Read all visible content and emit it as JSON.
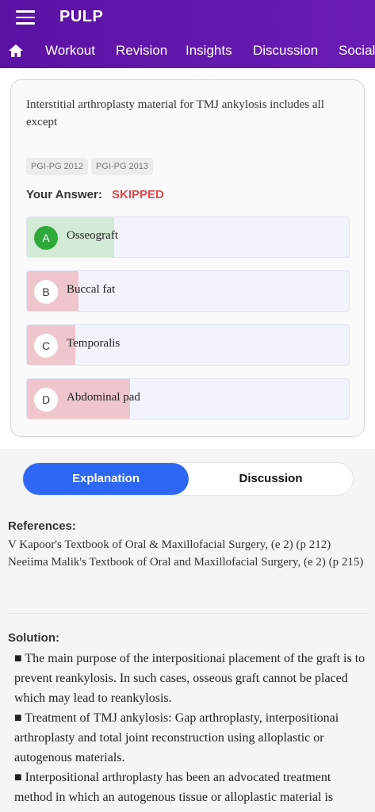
{
  "app": {
    "title": "PULP"
  },
  "nav": {
    "tabs": [
      "Workout",
      "Revision",
      "Insights",
      "Discussion",
      "Social"
    ]
  },
  "question": {
    "text": "Interstitial arthroplasty material for TMJ ankylosis includes all except",
    "tags": [
      "PGI-PG 2012",
      "PGI-PG 2013"
    ],
    "answer_label": "Your Answer:",
    "answer_value": "SKIPPED",
    "options": [
      {
        "letter": "A",
        "text": "Osseograft",
        "status": "correct",
        "share": 0.27
      },
      {
        "letter": "B",
        "text": "Buccal fat",
        "status": "wrong",
        "share": 0.16
      },
      {
        "letter": "C",
        "text": "Temporalis",
        "status": "wrong",
        "share": 0.15
      },
      {
        "letter": "D",
        "text": "Abdominal pad",
        "status": "wrong",
        "share": 0.32
      }
    ]
  },
  "toggle": {
    "explanation": "Explanation",
    "discussion": "Discussion"
  },
  "references": {
    "title": "References:",
    "items": [
      "V Kapoor's Textbook of Oral & Maxillofacial Surgery, (e 2) (p 212)",
      "Neeiima Malik's Textbook of Oral and Maxillofacial Surgery, (e 2) (p 215)"
    ]
  },
  "solution": {
    "title": "Solution:",
    "points": [
      "■ The main purpose of the interpositionai placement of the graft is to prevent reankylosis. In such cases, osseous graft cannot be placed which may lead to reankylosis.",
      "■ Treatment of TMJ ankylosis: Gap arthroplasty, interpositionai arthroplasty and total joint reconstruction using alloplastic or autogenous materials.",
      "■ Interpositional arthroplasty has been an advocated treatment method in which an autogenous tissue or alloplastic material is"
    ]
  },
  "colors": {
    "header": "#5b12a3",
    "correct": "#2eaa3c",
    "wrong_fill": "#efc6cd",
    "accent": "#2e67f5",
    "skipped": "#e0474c"
  }
}
